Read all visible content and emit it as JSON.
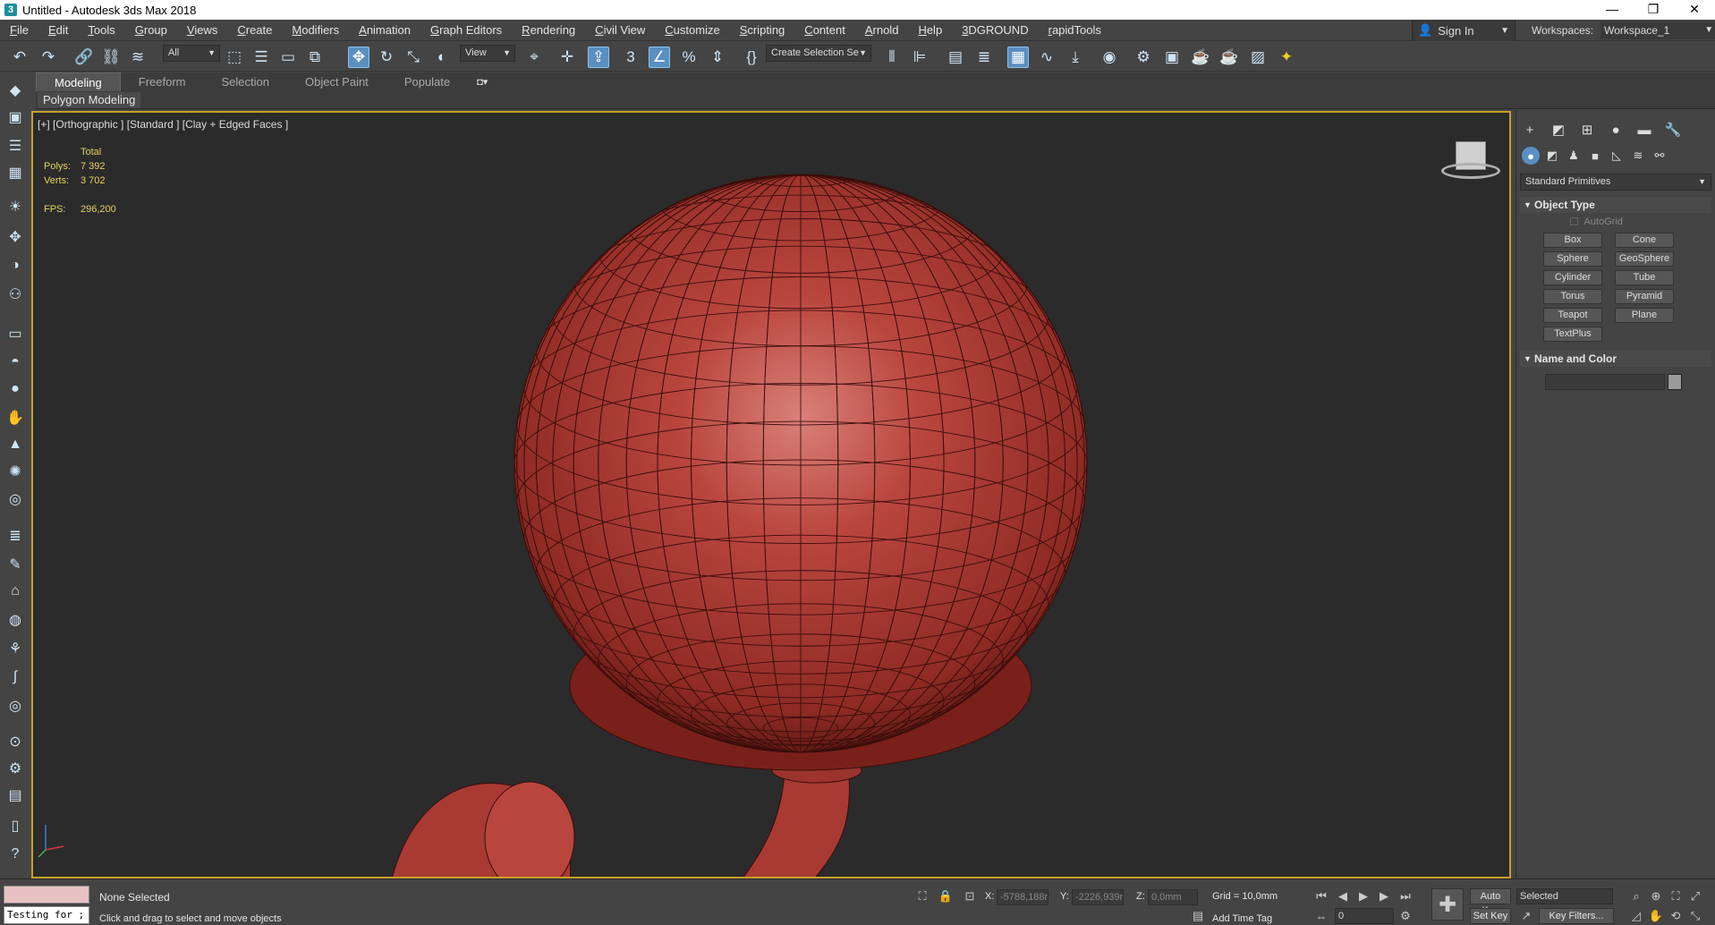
{
  "window": {
    "title": "Untitled - Autodesk 3ds Max 2018",
    "controls": [
      "—",
      "❐",
      "✕"
    ]
  },
  "menu": [
    "File",
    "Edit",
    "Tools",
    "Group",
    "Views",
    "Create",
    "Modifiers",
    "Animation",
    "Graph Editors",
    "Rendering",
    "Civil View",
    "Customize",
    "Scripting",
    "Content",
    "Arnold",
    "Help",
    "3DGROUND",
    "rapidTools"
  ],
  "account": {
    "sign_in": "Sign In",
    "workspaces_label": "Workspaces:",
    "workspace_value": "Workspace_1"
  },
  "toolbar": {
    "selection_filter": "All",
    "reference_coord": "View",
    "named_selection": "Create Selection Se",
    "accent_color": "#5a8fc2"
  },
  "ribbon": {
    "tabs": [
      "Modeling",
      "Freeform",
      "Selection",
      "Object Paint",
      "Populate"
    ],
    "active_tab": "Modeling",
    "panel_label": "Polygon Modeling"
  },
  "viewport": {
    "label": "[+] [Orthographic ] [Standard ] [Clay + Edged Faces ]",
    "stats_header": "Total",
    "polys_label": "Polys:",
    "polys_value": "7 392",
    "verts_label": "Verts:",
    "verts_value": "3 702",
    "fps_label": "FPS:",
    "fps_value": "296,200",
    "stats_color": "#e6d35b",
    "border_color": "#c8a02a",
    "model_color": "#b43c35"
  },
  "command_panel": {
    "category": "Standard Primitives",
    "object_type_title": "Object Type",
    "autogrid_label": "AutoGrid",
    "primitives": [
      [
        "Box",
        "Cone"
      ],
      [
        "Sphere",
        "GeoSphere"
      ],
      [
        "Cylinder",
        "Tube"
      ],
      [
        "Torus",
        "Pyramid"
      ],
      [
        "Teapot",
        "Plane"
      ],
      [
        "TextPlus",
        ""
      ]
    ],
    "name_color_title": "Name and Color"
  },
  "status": {
    "maxscript_text": "Testing for ;",
    "selection": "None Selected",
    "prompt": "Click and drag to select and move objects",
    "x_label": "X:",
    "x_value": "-5788,188r",
    "y_label": "Y:",
    "y_value": "-2226,939r",
    "z_label": "Z:",
    "z_value": "0,0mm",
    "grid": "Grid = 10,0mm",
    "add_time_tag": "Add Time Tag",
    "auto_key": "Auto Key",
    "set_key": "Set Key",
    "key_mode": "Selected",
    "key_filters": "Key Filters...",
    "frame": "0"
  }
}
